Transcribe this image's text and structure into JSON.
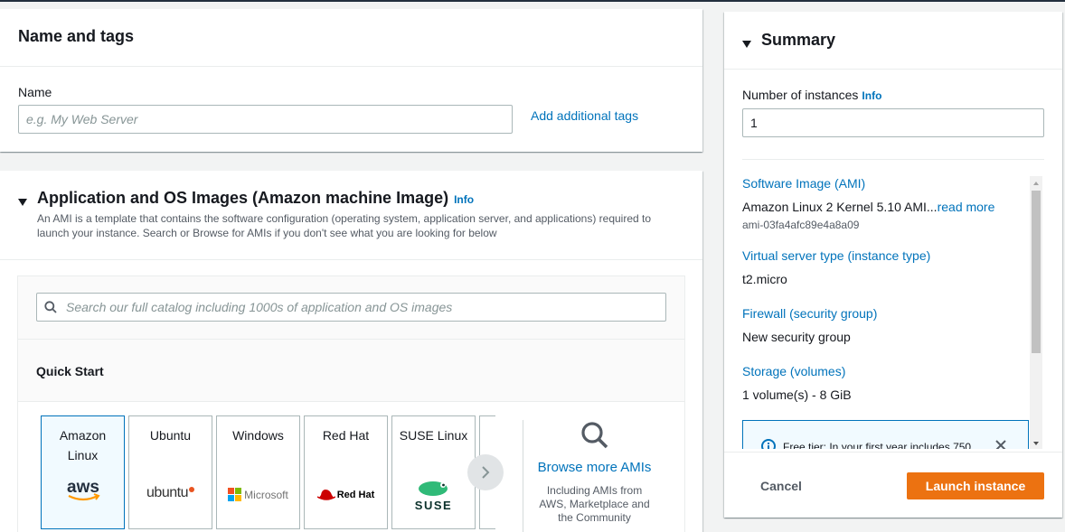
{
  "name_tags": {
    "heading": "Name and tags",
    "name_label": "Name",
    "name_placeholder": "e.g. My Web Server",
    "add_tags_link": "Add additional tags"
  },
  "ami_section": {
    "heading": "Application and OS Images (Amazon machine Image)",
    "info": "Info",
    "description": "An AMI is a template that contains the software configuration (operating system, application server, and applications) required to launch your instance. Search or Browse for AMIs if you don't see what you are looking for below",
    "search_placeholder": "Search our full catalog including 1000s of application and OS images",
    "quick_start": "Quick Start",
    "tiles": [
      {
        "name_line1": "Amazon",
        "name_line2": "Linux",
        "logo": "aws"
      },
      {
        "name_line1": "Ubuntu",
        "logo": "ubuntu"
      },
      {
        "name_line1": "Windows",
        "logo": "Microsoft"
      },
      {
        "name_line1": "Red Hat",
        "logo": "Red Hat"
      },
      {
        "name_line1": "SUSE Linux",
        "logo": "SUSE"
      }
    ],
    "browse_more": "Browse more AMIs",
    "browse_sub": "Including AMIs from AWS, Marketplace and the Community"
  },
  "summary": {
    "heading": "Summary",
    "instances_label": "Number of instances",
    "instances_info": "Info",
    "instances_value": "1",
    "ami_label": "Software Image (AMI)",
    "ami_value": "Amazon Linux 2 Kernel 5.10 AMI...",
    "ami_read_more": "read more",
    "ami_id": "ami-03fa4afc89e4a8a09",
    "instance_type_label": "Virtual server type (instance type)",
    "instance_type_value": "t2.micro",
    "firewall_label": "Firewall (security group)",
    "firewall_value": "New security group",
    "storage_label": "Storage (volumes)",
    "storage_value": "1 volume(s) - 8 GiB",
    "free_tier_text": "Free tier: In your first year includes 750",
    "cancel": "Cancel",
    "launch": "Launch instance"
  },
  "colors": {
    "primary": "#ec7211",
    "link": "#0073bb",
    "background": "#f2f3f3"
  }
}
